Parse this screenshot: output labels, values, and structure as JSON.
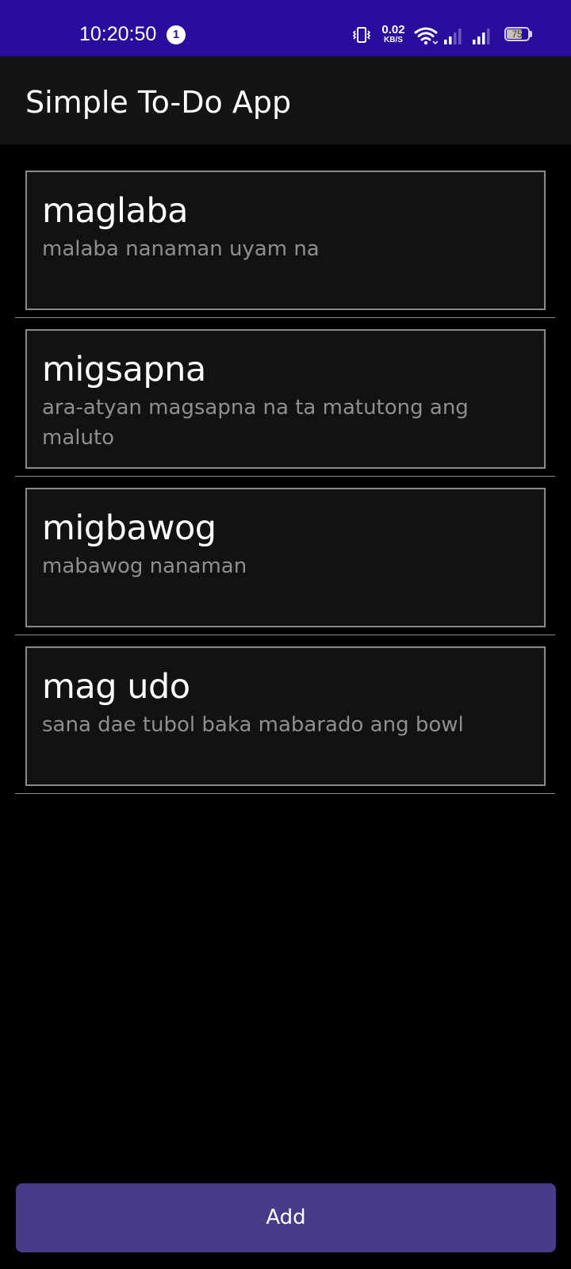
{
  "status_bar": {
    "time": "10:20:50",
    "notification_count": "1",
    "net_speed_value": "0.02",
    "net_speed_unit": "KB/S",
    "battery_level": "75",
    "battery_fraction": 0.75,
    "icons": [
      "vibrate-icon",
      "wifi-icon",
      "signal-icon",
      "signal-icon",
      "battery-icon"
    ]
  },
  "app_bar": {
    "title": "Simple To-Do App"
  },
  "todos": [
    {
      "title": "maglaba",
      "description": "malaba nanaman uyam na"
    },
    {
      "title": "migsapna",
      "description": "ara-atyan magsapna na ta matutong ang maluto"
    },
    {
      "title": "migbawog",
      "description": "mabawog nanaman"
    },
    {
      "title": "mag udo",
      "description": "sana dae tubol baka mabarado ang bowl"
    }
  ],
  "add_button": {
    "label": "Add"
  },
  "colors": {
    "status_bar_bg": "#2a0d9c",
    "app_bar_bg": "#141414",
    "background": "#000000",
    "card_bg": "#121212",
    "card_border": "#8a8a8a",
    "description_text": "#8f8f8f",
    "button_bg": "#483b8b"
  }
}
